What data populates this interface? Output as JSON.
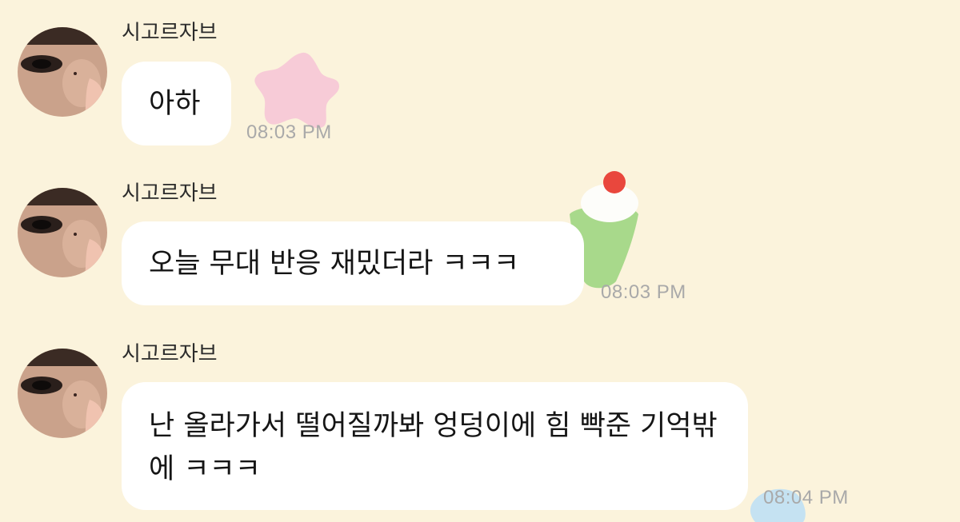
{
  "chat": {
    "messages": [
      {
        "sender": "시고르자브",
        "text": "아하",
        "time": "08:03 PM"
      },
      {
        "sender": "시고르자브",
        "text": "오늘 무대 반응 재밌더라 ㅋㅋㅋ",
        "time": "08:03 PM"
      },
      {
        "sender": "시고르자브",
        "text": "난 올라가서 떨어질까봐 엉덩이에 힘 빡준 기억밖에 ㅋㅋㅋ",
        "time": "08:04 PM"
      }
    ]
  },
  "theme": {
    "background": "#fbf3dc",
    "bubble": "#ffffff",
    "time_color": "#a9a9a9"
  },
  "decorations": [
    "pink-star-sticker",
    "cherry-dessert-sticker",
    "blue-blob-sticker"
  ]
}
